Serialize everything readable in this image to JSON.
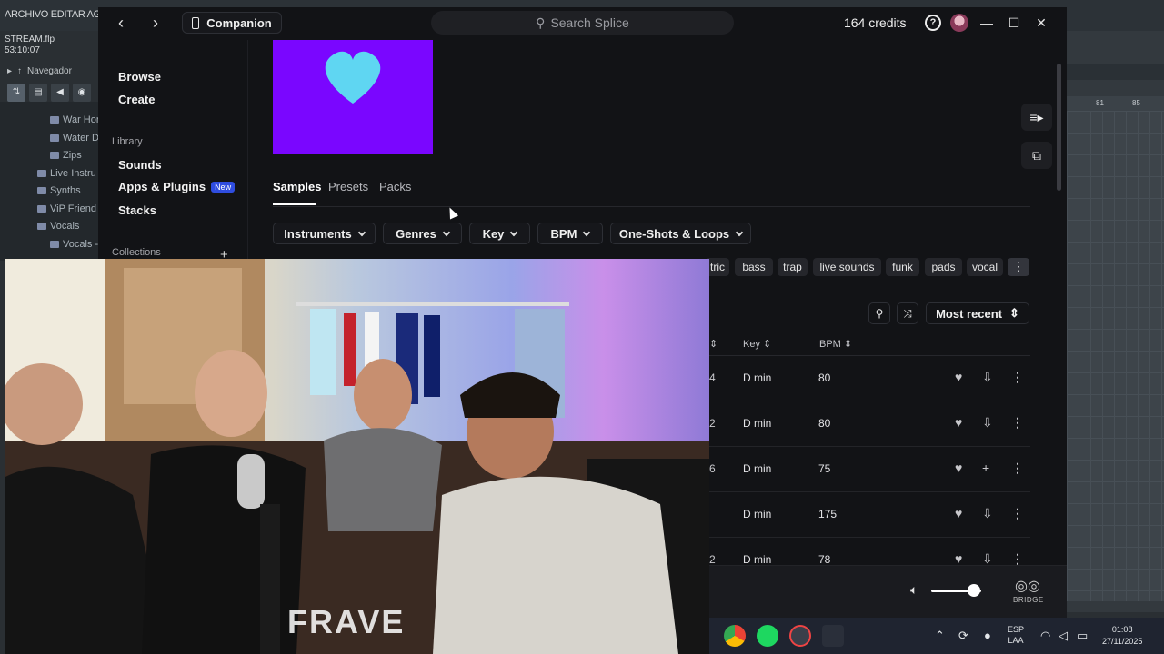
{
  "fl": {
    "menu": "ARCHIVO EDITAR AGREGAR",
    "project_name": "STREAM.flp",
    "project_time": "53:10:07",
    "navigator_label": "Navegador",
    "browser_items": [
      "War Hor",
      "Water D",
      "Zips",
      "Live Instru",
      "Synths",
      "ViP Friend",
      "Vocals",
      "Vocals - /"
    ],
    "ruler_marks": [
      "81",
      "85"
    ]
  },
  "splice": {
    "companion_label": "Companion",
    "search_placeholder": "Search Splice",
    "credits": "164 credits",
    "sidebar": {
      "browse": "Browse",
      "create": "Create",
      "library_label": "Library",
      "sounds": "Sounds",
      "apps_plugins": "Apps & Plugins",
      "new_badge": "New",
      "stacks": "Stacks",
      "collections_label": "Collections",
      "add_symbol": "+"
    },
    "tabs": [
      "Samples",
      "Presets",
      "Packs"
    ],
    "filters": [
      "Instruments",
      "Genres",
      "Key",
      "BPM",
      "One-Shots & Loops"
    ],
    "tags": [
      "tric",
      "bass",
      "trap",
      "live sounds",
      "funk",
      "pads",
      "vocal"
    ],
    "sort_label": "Most recent",
    "columns": {
      "key": "Key",
      "bpm": "BPM"
    },
    "rows": [
      {
        "cut": "4",
        "key": "D min",
        "bpm": "80",
        "action": "download"
      },
      {
        "cut": "2",
        "key": "D min",
        "bpm": "80",
        "action": "download"
      },
      {
        "cut": "6",
        "key": "D min",
        "bpm": "75",
        "action": "add"
      },
      {
        "cut": "",
        "key": "D min",
        "bpm": "175",
        "action": "download"
      },
      {
        "cut": "2",
        "key": "D min",
        "bpm": "78",
        "action": "download"
      }
    ],
    "player": {
      "bridge_label": "BRIDGE",
      "volume_level": 0.85
    },
    "colors": {
      "pack_art": "#7a06ff",
      "heart": "#5fd6f2",
      "accent_badge": "#2f4de0"
    }
  },
  "taskbar": {
    "lang_primary": "ESP",
    "lang_secondary": "LAA",
    "time": "01:08",
    "date": "27/11/2025"
  },
  "webcam": {
    "overlay_text": "FRAVE"
  }
}
